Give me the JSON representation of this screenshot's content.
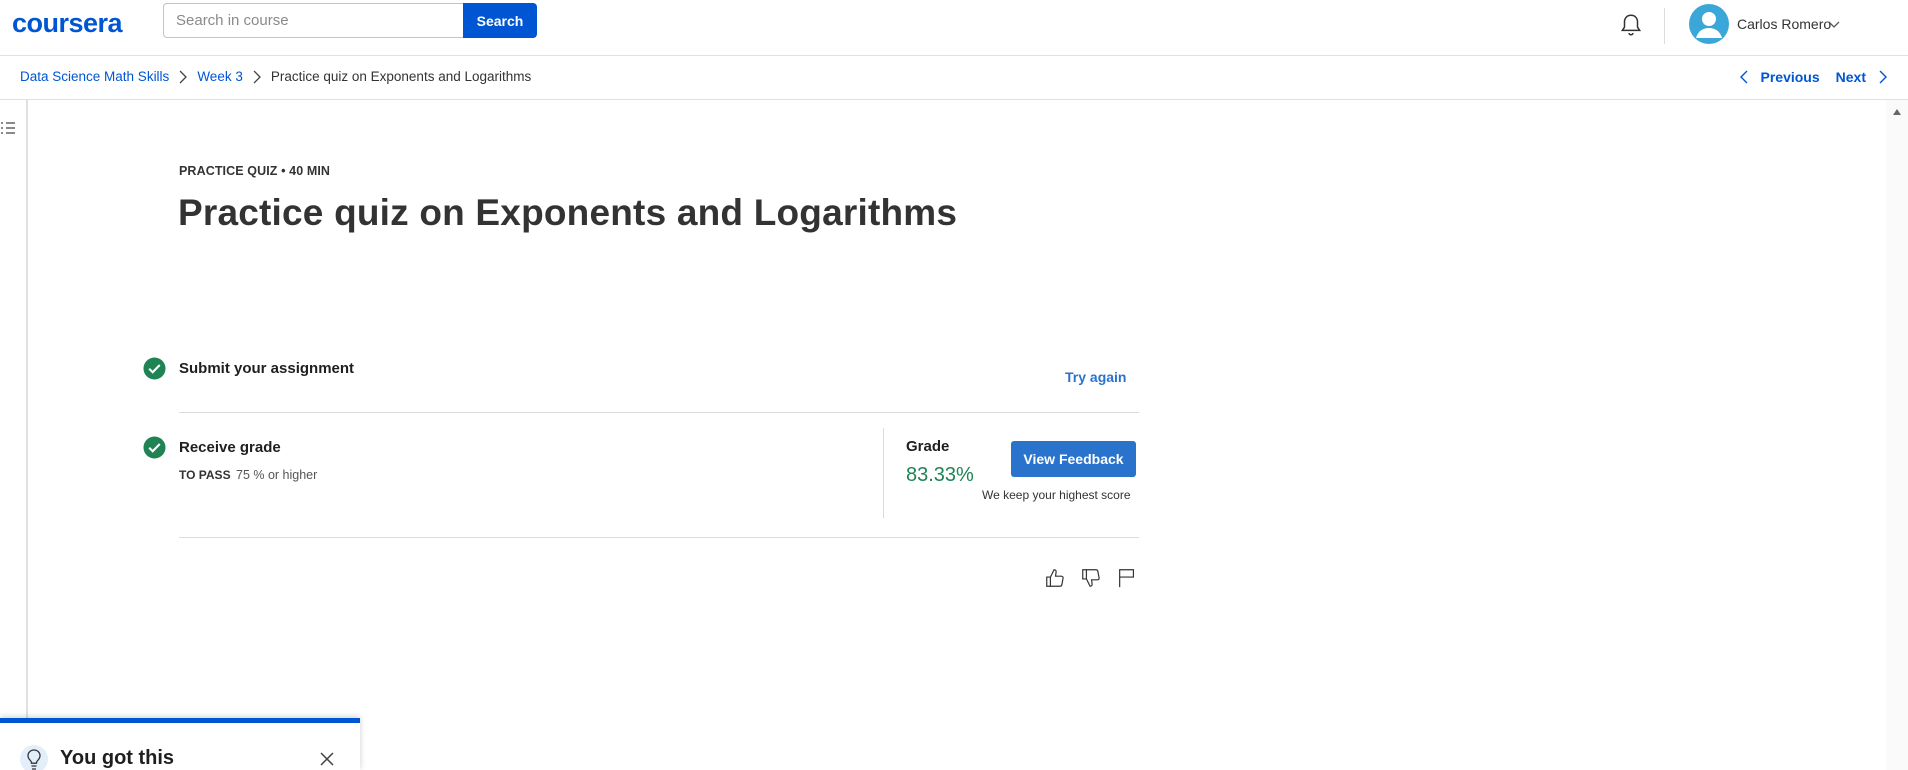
{
  "header": {
    "logo": "coursera",
    "search_placeholder": "Search in course",
    "search_button": "Search",
    "user_name": "Carlos Romero"
  },
  "breadcrumb": {
    "items": [
      "Data Science Math Skills",
      "Week 3"
    ],
    "current": "Practice quiz on Exponents and Logarithms"
  },
  "nav": {
    "previous": "Previous",
    "next": "Next"
  },
  "quiz": {
    "eyebrow": "PRACTICE QUIZ • 40 MIN",
    "title": "Practice quiz on Exponents and Logarithms",
    "submit": {
      "title": "Submit your assignment",
      "action": "Try again"
    },
    "receive": {
      "title": "Receive grade",
      "pass_label": "TO PASS",
      "pass_value": "75 % or higher"
    },
    "grade": {
      "label": "Grade",
      "value": "83.33%",
      "button": "View Feedback",
      "note": "We keep your highest score"
    }
  },
  "toast": {
    "title": "You got this"
  },
  "colors": {
    "brand": "#0056d2",
    "success": "#1f8354",
    "button": "#2a73cc"
  }
}
